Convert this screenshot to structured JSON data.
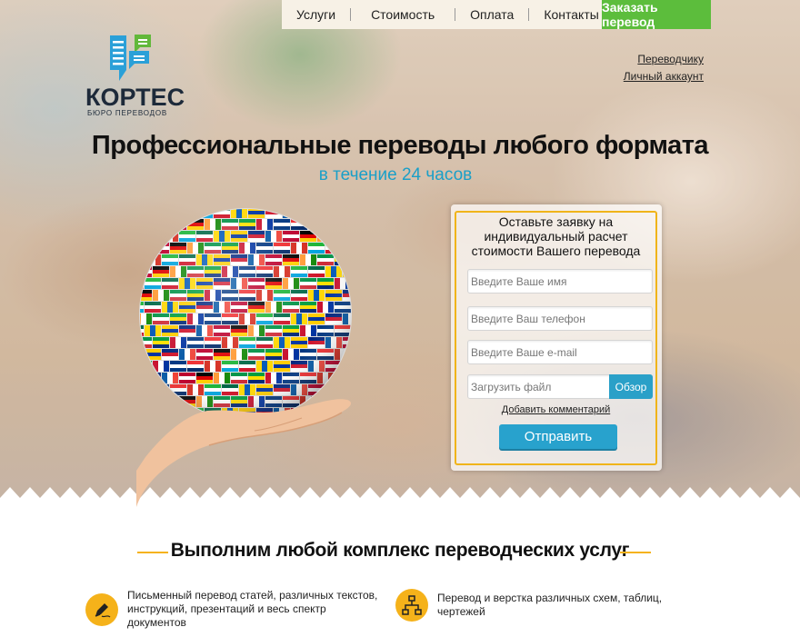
{
  "nav": {
    "items": [
      "Услуги",
      "Стоимость",
      "Оплата",
      "Контакты"
    ],
    "order_button": "Заказать перевод"
  },
  "logo": {
    "name": "КОРТЕС",
    "subtitle": "БЮРО ПЕРЕВОДОВ"
  },
  "side_links": {
    "translator": "Переводчику",
    "account": "Личный аккаунт"
  },
  "hero": {
    "headline": "Профессиональные переводы любого формата",
    "subheadline": "в течение 24 часов"
  },
  "form": {
    "title": "Оставьте заявку на индивидуальный расчет стоимости Вашего перевода",
    "name_placeholder": "Введите Ваше имя",
    "phone_placeholder": "Введите Ваш телефон",
    "email_placeholder": "Введите Ваше e-mail",
    "file_placeholder": "Загрузить файл",
    "browse_label": "Обзор",
    "comment_link": "Добавить комментарий",
    "submit_label": "Отправить"
  },
  "services": {
    "title": "Выполним любой комплекс переводческих услуг",
    "items": [
      {
        "icon": "pen-icon",
        "text": "Письменный перевод статей, различных текстов, инструкций, презентаций и весь спектр документов"
      },
      {
        "icon": "hierarchy-icon",
        "text": "Перевод и верстка различных схем, таблиц, чертежей"
      }
    ]
  },
  "colors": {
    "accent_green": "#5cbd3c",
    "accent_blue": "#28a2cd",
    "accent_orange": "#f5b21a"
  }
}
